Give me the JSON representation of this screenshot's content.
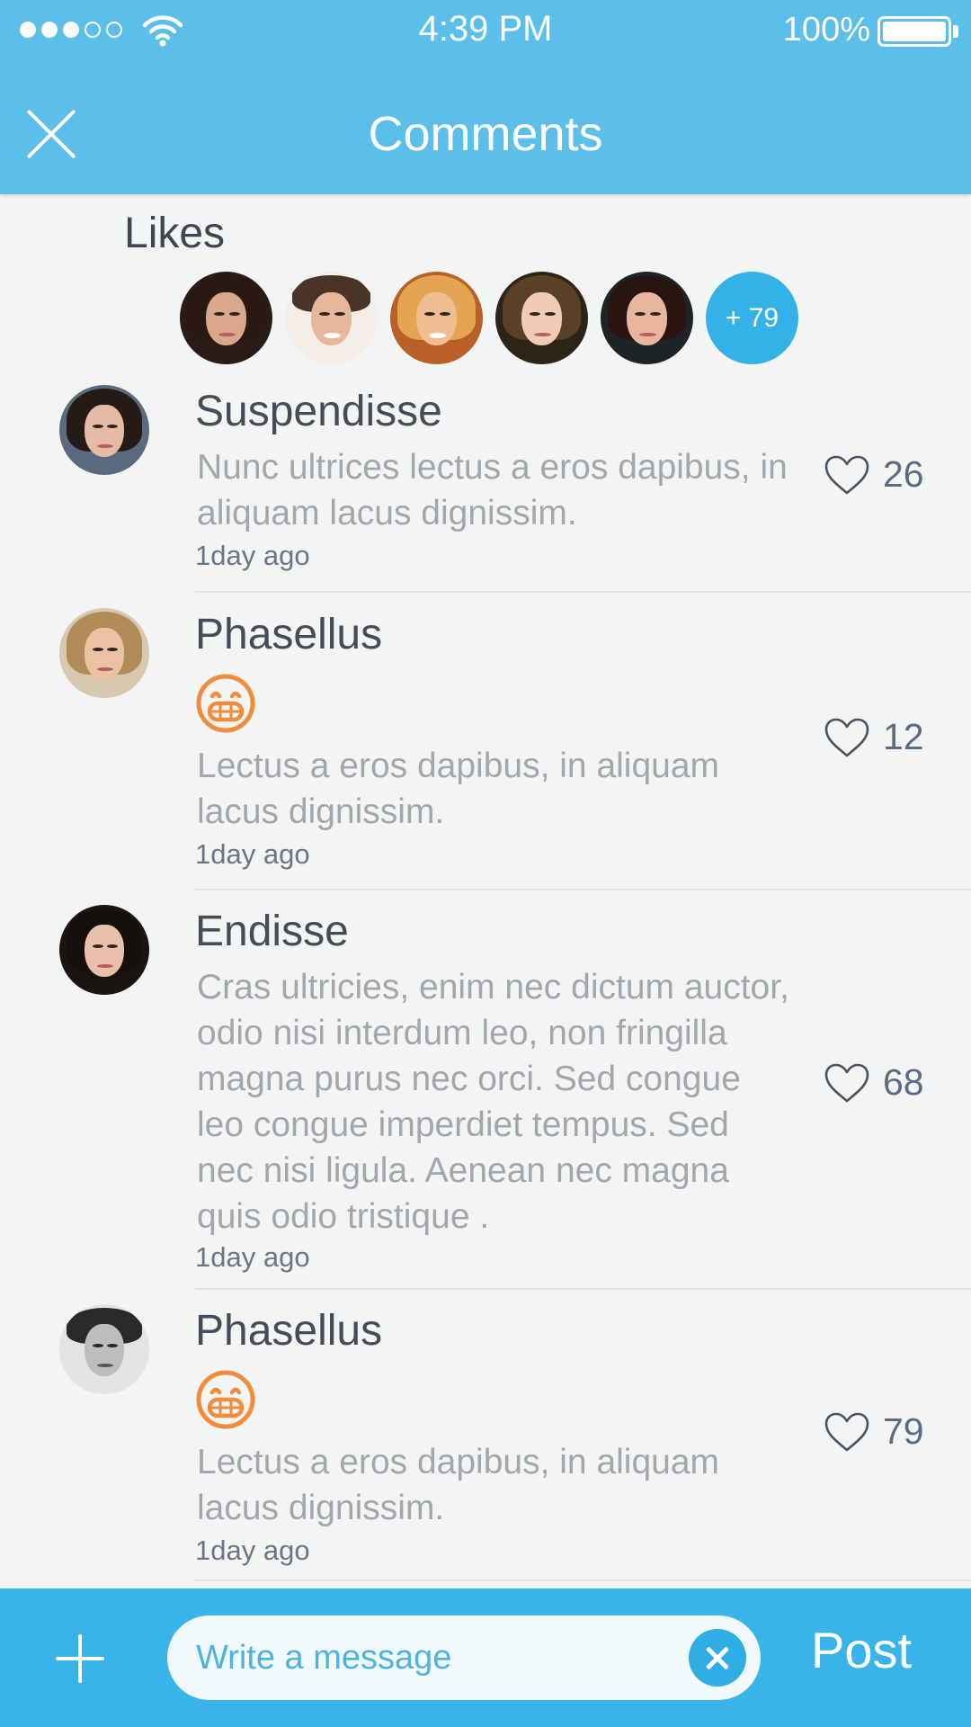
{
  "status_bar": {
    "time": "4:39 PM",
    "battery": "100%",
    "signal_bars_filled": 3,
    "signal_bars_total": 5
  },
  "header": {
    "title": "Comments"
  },
  "likes": {
    "title": "Likes",
    "more_count": "+ 79"
  },
  "comments": [
    {
      "name": "Suspendisse",
      "text": "Nunc ultrices lectus a eros dapibus, in aliquam lacus dignissim.",
      "time": "1day ago",
      "likes": "26",
      "emoji": false
    },
    {
      "name": "Phasellus",
      "text": "Lectus a eros dapibus, in aliquam lacus dignissim.",
      "time": "1day ago",
      "likes": "12",
      "emoji": true
    },
    {
      "name": "Endisse",
      "text": "Cras ultricies, enim nec dictum auctor, odio nisi interdum leo, non fringilla magna purus nec orci. Sed congue leo congue imperdiet tempus. Sed nec nisi ligula. Aenean nec magna quis odio tristique .",
      "time": "1day ago",
      "likes": "68",
      "emoji": false
    },
    {
      "name": "Phasellus",
      "text": "Lectus a eros dapibus, in aliquam lacus dignissim.",
      "time": "1day ago",
      "likes": "79",
      "emoji": true
    }
  ],
  "composer": {
    "placeholder": "Write a message",
    "post_label": "Post"
  },
  "colors": {
    "header": "#5bbfe9",
    "bottom_bar": "#39b4e9",
    "accent": "#34b2e8",
    "emoji": "#f08c3c"
  }
}
